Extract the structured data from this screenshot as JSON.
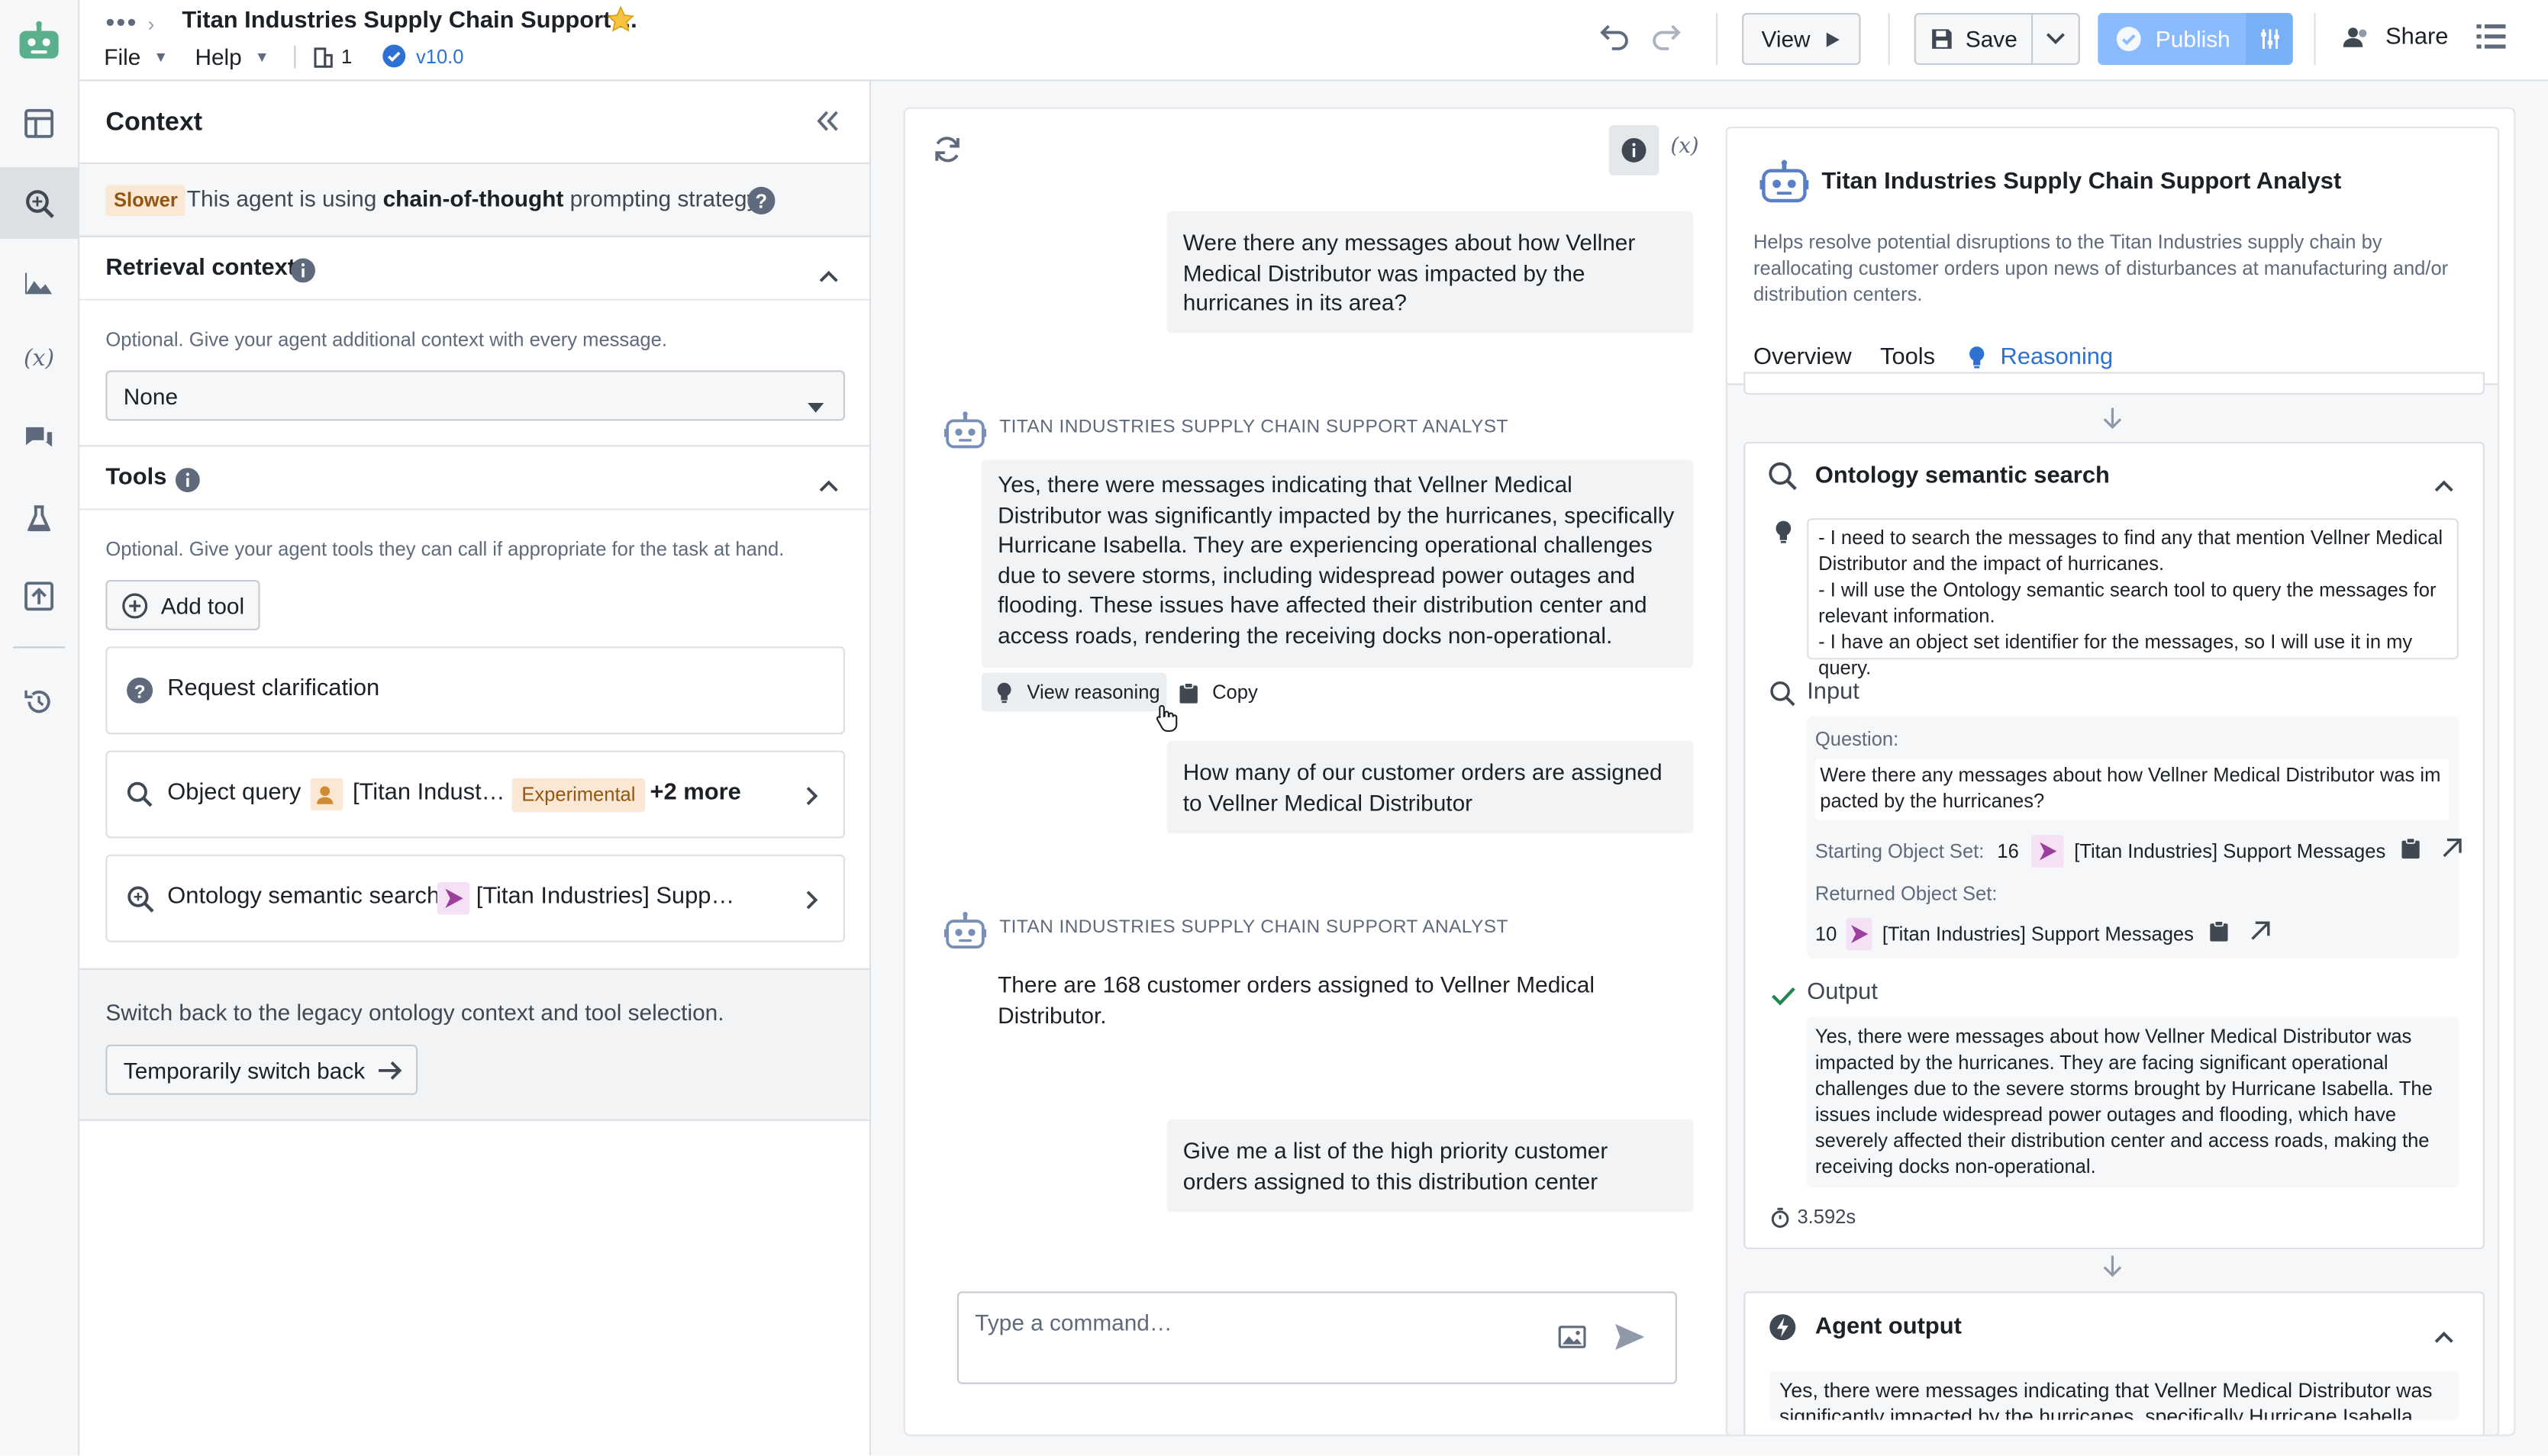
{
  "header": {
    "title": "Titan Industries Supply Chain Support ...",
    "menu_file": "File",
    "menu_help": "Help",
    "branch_count": "1",
    "version": "v10.0",
    "view_label": "View",
    "save_label": "Save",
    "publish_label": "Publish",
    "share_label": "Share"
  },
  "context": {
    "title": "Context",
    "strategy_badge": "Slower",
    "strategy_prefix": "This agent is using",
    "strategy_bold": "chain-of-thought",
    "strategy_suffix": "prompting strategy",
    "retrieval_title": "Retrieval context",
    "retrieval_desc": "Optional. Give your agent additional context with every message.",
    "retrieval_value": "None",
    "tools_title": "Tools",
    "tools_desc": "Optional. Give your agent tools they can call if appropriate for the task at hand.",
    "add_tool_label": "Add tool",
    "tools": [
      {
        "name": "Request clarification"
      },
      {
        "name": "Object query",
        "object": "[Titan Indust…",
        "tag": "Experimental",
        "more": "+2 more"
      },
      {
        "name": "Ontology semantic search",
        "object": "[Titan Industries] Supp…"
      }
    ],
    "legacy_text": "Switch back to the legacy ontology context and tool selection.",
    "legacy_button": "Temporarily switch back"
  },
  "chat": {
    "messages": [
      {
        "role": "user",
        "text": "Were there any messages about how Vellner Medical Distributor was impacted by the hurricanes in its area?"
      },
      {
        "role": "agent",
        "label": "Titan Industries Supply Chain Support Analyst",
        "text": "Yes, there were messages indicating that Vellner Medical Distributor was significantly impacted by the hurricanes, specifically Hurricane Isabella. They are experiencing operational challenges due to severe storms, including widespread power outages and flooding. These issues have affected their distribution center and access roads, rendering the receiving docks non-operational."
      },
      {
        "role": "user",
        "text": "How many of our customer orders are assigned to Vellner Medical Distributor"
      },
      {
        "role": "agent",
        "label": "Titan Industries Supply Chain Support Analyst",
        "text": "There are 168 customer orders assigned to Vellner Medical Distributor."
      },
      {
        "role": "user",
        "text": "Give me a list of the high priority customer orders assigned to this distribution center"
      }
    ],
    "view_reasoning": "View reasoning",
    "copy": "Copy",
    "variable_label": "(x)",
    "input_placeholder": "Type a command…"
  },
  "panel": {
    "title": "Titan Industries Supply Chain Support Analyst",
    "description": "Helps resolve potential disruptions to the Titan Industries supply chain by reallocating customer orders upon news of disturbances at manufacturing and/or distribution centers.",
    "tabs": [
      "Overview",
      "Tools",
      "Reasoning"
    ],
    "search_card": {
      "title": "Ontology semantic search",
      "thought": "- I need to search the messages to find any that mention Vellner Medical Distributor and the impact of hurricanes.\n- I will use the Ontology semantic search tool to query the messages for relevant information.\n- I have an object set identifier for the messages, so I will use it in my query.",
      "input_label": "Input",
      "question_label": "Question:",
      "question": "Were there any messages about how Vellner Medical Distributor was impacted by the hurricanes?",
      "starting_label": "Starting Object Set:",
      "starting_count": "16",
      "starting_name": "[Titan Industries] Support Messages",
      "returned_label": "Returned Object Set:",
      "returned_count": "10",
      "returned_name": "[Titan Industries] Support Messages",
      "output_label": "Output",
      "output": "Yes, there were messages about how Vellner Medical Distributor was impacted by the hurricanes. They are facing significant operational challenges due to the severe storms brought by Hurricane Isabella. The issues include widespread power outages and flooding, which have severely affected their distribution center and access roads, making the receiving docks non-operational.",
      "duration": "3.592s"
    },
    "agent_output_title": "Agent output",
    "agent_output": "Yes, there were messages indicating that Vellner Medical Distributor was significantly impacted by the hurricanes, specifically Hurricane Isabella. They"
  },
  "colors": {
    "accent": "#2d72d2",
    "publish": "#8abbff",
    "badge_bg": "#fbe8d4",
    "badge_text": "#935610",
    "experimental": "#b07b2b",
    "purple": "#9d3f9d"
  }
}
